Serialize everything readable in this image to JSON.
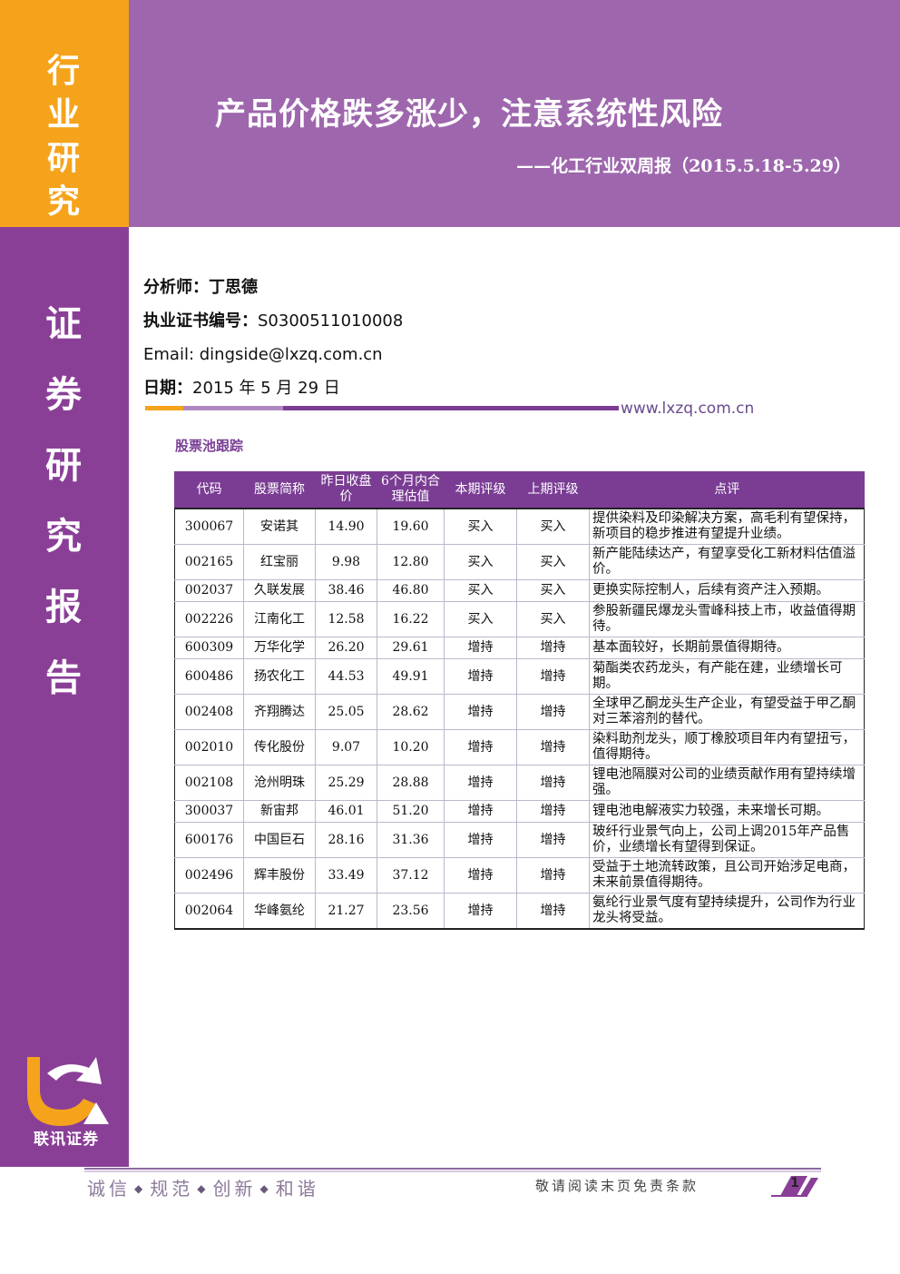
{
  "tag": {
    "lines": [
      "行",
      "业",
      "研",
      "究"
    ]
  },
  "header": {
    "title": "产品价格跌多涨少，注意系统性风险",
    "subtitle": "——化工行业双周报（2015.5.18-5.29）"
  },
  "sidebar": {
    "lines": [
      "证",
      "券",
      "研",
      "究",
      "报",
      "告"
    ],
    "logo_text": "联讯证券"
  },
  "info": {
    "analyst_label": "分析师：",
    "analyst": "丁思德",
    "cert_label": "执业证书编号：",
    "cert": "S0300511010008",
    "email_label": "Email: ",
    "email": "dingside@lxzq.com.cn",
    "date_label": "日期：",
    "date": "2015 年 5 月 29 日",
    "website": "www.lxzq.com.cn"
  },
  "pool": {
    "title": "股票池跟踪",
    "headers": [
      "代码",
      "股票简称",
      "昨日收盘价",
      "6个月内合理估值",
      "本期评级",
      "上期评级",
      "点评"
    ],
    "rows": [
      [
        "300067",
        "安诺其",
        "14.90",
        "19.60",
        "买入",
        "买入",
        "提供染料及印染解决方案，高毛利有望保持，新项目的稳步推进有望提升业绩。"
      ],
      [
        "002165",
        "红宝丽",
        "9.98",
        "12.80",
        "买入",
        "买入",
        "新产能陆续达产，有望享受化工新材料估值溢价。"
      ],
      [
        "002037",
        "久联发展",
        "38.46",
        "46.80",
        "买入",
        "买入",
        "更换实际控制人，后续有资产注入预期。"
      ],
      [
        "002226",
        "江南化工",
        "12.58",
        "16.22",
        "买入",
        "买入",
        "参股新疆民爆龙头雪峰科技上市，收益值得期待。"
      ],
      [
        "600309",
        "万华化学",
        "26.20",
        "29.61",
        "增持",
        "增持",
        "基本面较好，长期前景值得期待。"
      ],
      [
        "600486",
        "扬农化工",
        "44.53",
        "49.91",
        "增持",
        "增持",
        "菊酯类农药龙头，有产能在建，业绩增长可期。"
      ],
      [
        "002408",
        "齐翔腾达",
        "25.05",
        "28.62",
        "增持",
        "增持",
        "全球甲乙酮龙头生产企业，有望受益于甲乙酮对三苯溶剂的替代。"
      ],
      [
        "002010",
        "传化股份",
        "9.07",
        "10.20",
        "增持",
        "增持",
        "染料助剂龙头，顺丁橡胶项目年内有望扭亏，值得期待。"
      ],
      [
        "002108",
        "沧州明珠",
        "25.29",
        "28.88",
        "增持",
        "增持",
        "锂电池隔膜对公司的业绩贡献作用有望持续增强。"
      ],
      [
        "300037",
        "新宙邦",
        "46.01",
        "51.20",
        "增持",
        "增持",
        "锂电池电解液实力较强，未来增长可期。"
      ],
      [
        "600176",
        "中国巨石",
        "28.16",
        "31.36",
        "增持",
        "增持",
        "玻纤行业景气向上，公司上调2015年产品售价，业绩增长有望得到保证。"
      ],
      [
        "002496",
        "辉丰股份",
        "33.49",
        "37.12",
        "增持",
        "增持",
        "受益于土地流转政策，且公司开始涉足电商，未来前景值得期待。"
      ],
      [
        "002064",
        "华峰氨纶",
        "21.27",
        "23.56",
        "增持",
        "增持",
        "氨纶行业景气度有望持续提升，公司作为行业龙头将受益。"
      ]
    ]
  },
  "footer": {
    "slogan": [
      "诚信",
      "规范",
      "创新",
      "和谐"
    ],
    "disclaimer": "敬请阅读末页免责条款",
    "page": "1"
  },
  "colors": {
    "purple": "#8a3f97",
    "header_purple": "#9e67ad",
    "orange": "#f5a31b",
    "table_header": "#7b3d94"
  }
}
